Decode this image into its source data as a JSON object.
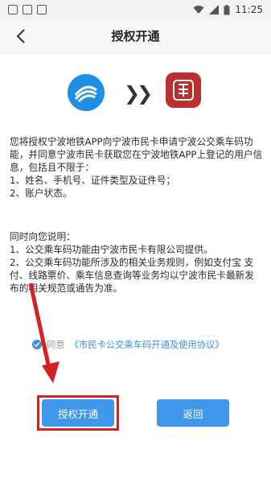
{
  "status_bar": {
    "time": "11:25"
  },
  "nav": {
    "title": "授权开通"
  },
  "intro": {
    "paragraph": "您将授权宁波地铁APP向宁波市民卡申请宁波公交乘车码功能，并同意宁波市民卡获取您在宁波地铁APP上登记的用户信息，包括且不限于：",
    "item1": "1、姓名、手机号、证件类型及证件号；",
    "item2": "2、账户状态。"
  },
  "notice": {
    "heading": "同时向您说明：",
    "item1": "1、公交乘车码功能由宁波市民卡有限公司提供。",
    "item2": "2、公交乘车码功能所涉及的相关业务规则，例如支付宝        支付、线路票价、乘车信息查询等业务均以宁波市民卡最新发布的相关规范或通告为准。"
  },
  "agreement": {
    "prefix": "同意",
    "link": "《市民卡公交乘车码开通及使用协议》"
  },
  "buttons": {
    "authorize": "授权开通",
    "return": "返回"
  },
  "colors": {
    "accent": "#3e97e8",
    "highlight": "#d42020",
    "metro_logo": "#1d8fe6",
    "card_logo": "#b9302e"
  }
}
